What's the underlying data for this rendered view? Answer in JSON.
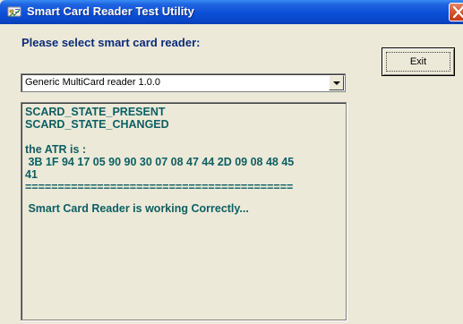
{
  "window": {
    "title": "Smart Card Reader Test Utility",
    "icons": {
      "app": "smart-card-app-icon",
      "close": "close-icon"
    },
    "colors": {
      "title_bar": "#0b4fd8",
      "prompt_text": "#0b2c7a",
      "output_text": "#0d5f63",
      "background": "#ece9d8",
      "close_button": "#d9532f"
    }
  },
  "prompt": "Please select smart card reader:",
  "exit_button": "Exit",
  "reader_select": {
    "value": "Generic MultiCard reader 1.0.0"
  },
  "output": {
    "state_present": "SCARD_STATE_PRESENT",
    "state_changed": "SCARD_STATE_CHANGED",
    "atr_label": "the ATR is :",
    "atr_bytes_line1": " 3B 1F 94 17 05 90 90 30 07 08 47 44 2D 09 08 48 45",
    "atr_bytes_line2": "41",
    "separator": "=========================================",
    "status": " Smart Card Reader is working Correctly..."
  }
}
